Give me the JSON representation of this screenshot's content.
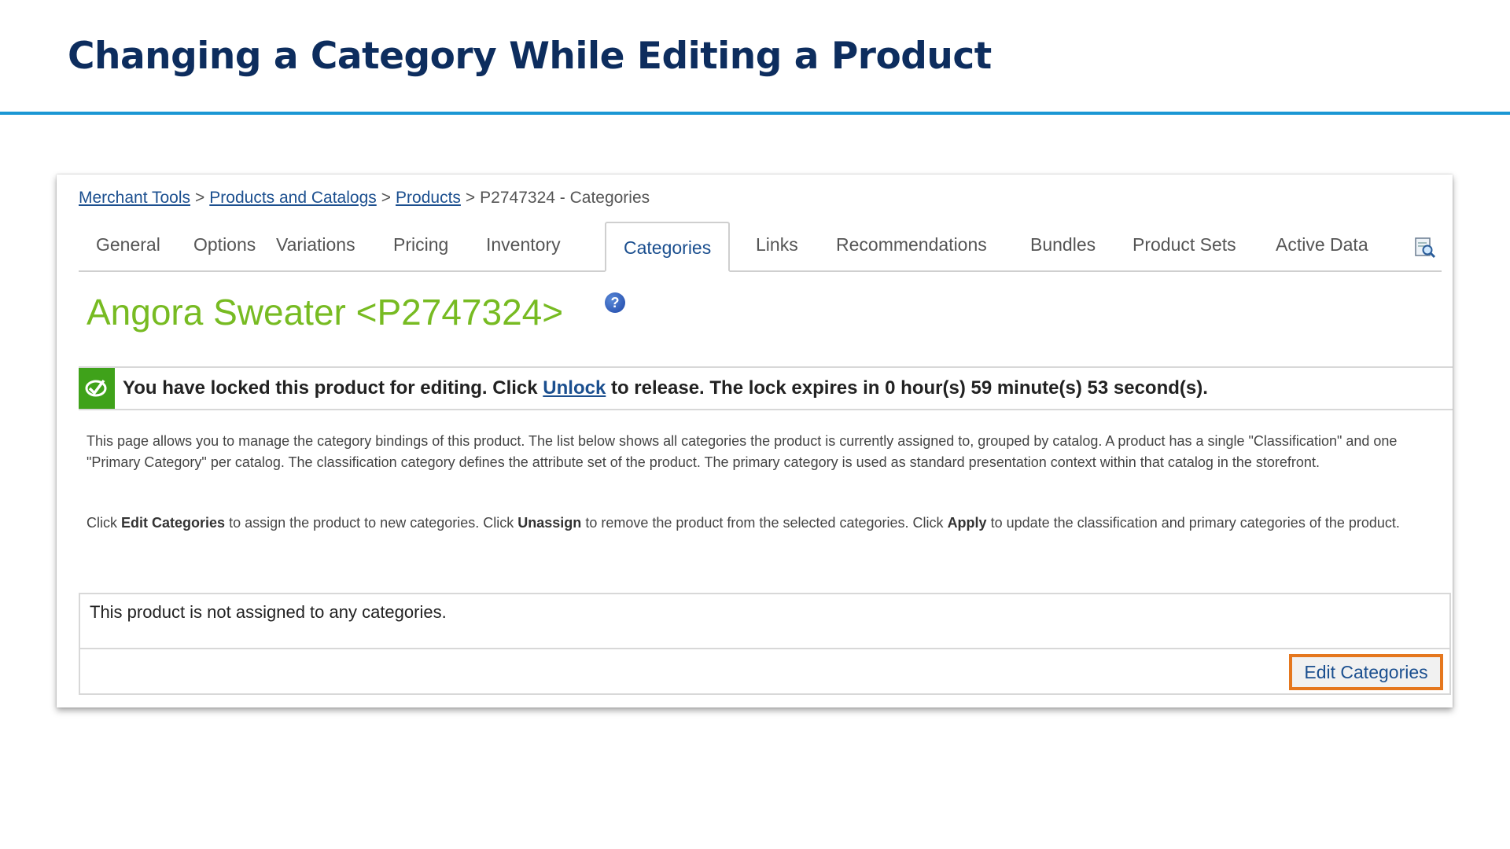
{
  "slide": {
    "title": "Changing a Category While Editing a Product"
  },
  "breadcrumb": {
    "items": [
      "Merchant Tools",
      "Products and Catalogs",
      "Products"
    ],
    "current": "P2747324 - Categories",
    "separator": ">"
  },
  "tabs": [
    {
      "label": "General"
    },
    {
      "label": "Options"
    },
    {
      "label": "Variations"
    },
    {
      "label": "Pricing"
    },
    {
      "label": "Inventory"
    },
    {
      "label": "Categories",
      "active": true
    },
    {
      "label": "Links"
    },
    {
      "label": "Recommendations"
    },
    {
      "label": "Bundles"
    },
    {
      "label": "Product Sets"
    },
    {
      "label": "Active Data"
    }
  ],
  "tab_icon": "preview-magnify-icon",
  "product": {
    "title": "Angora Sweater <P2747324>",
    "help_icon": "help-icon"
  },
  "lock": {
    "icon": "lock-check-icon",
    "prefix": "You have locked this product for editing. Click",
    "link": "Unlock",
    "suffix": "to release. The lock expires in 0 hour(s) 59 minute(s) 53 second(s)."
  },
  "description": {
    "para1": "This page allows you to manage the category bindings of this product. The list below shows all categories the product is currently assigned to, grouped by catalog. A product has a single \"Classification\" and one \"Primary Category\" per catalog. The classification category defines the attribute set of the product. The primary category is used as standard presentation context within that catalog in the storefront.",
    "para2_a": "Click",
    "para2_b": "Edit Categories",
    "para2_c": "to assign the product to new categories. Click",
    "para2_d": "Unassign",
    "para2_e": "to remove the product from the selected categories. Click",
    "para2_f": "Apply",
    "para2_g": "to update the classification and primary categories of the product."
  },
  "assignment": {
    "empty_message": "This product is not assigned to any categories.",
    "edit_button": "Edit Categories"
  },
  "colors": {
    "title": "#0d2d5e",
    "rule": "#1b97d4",
    "link": "#1b4f8f",
    "product_title": "#77bb22",
    "lock_green": "#3fa21a",
    "highlight": "#e5771e"
  }
}
